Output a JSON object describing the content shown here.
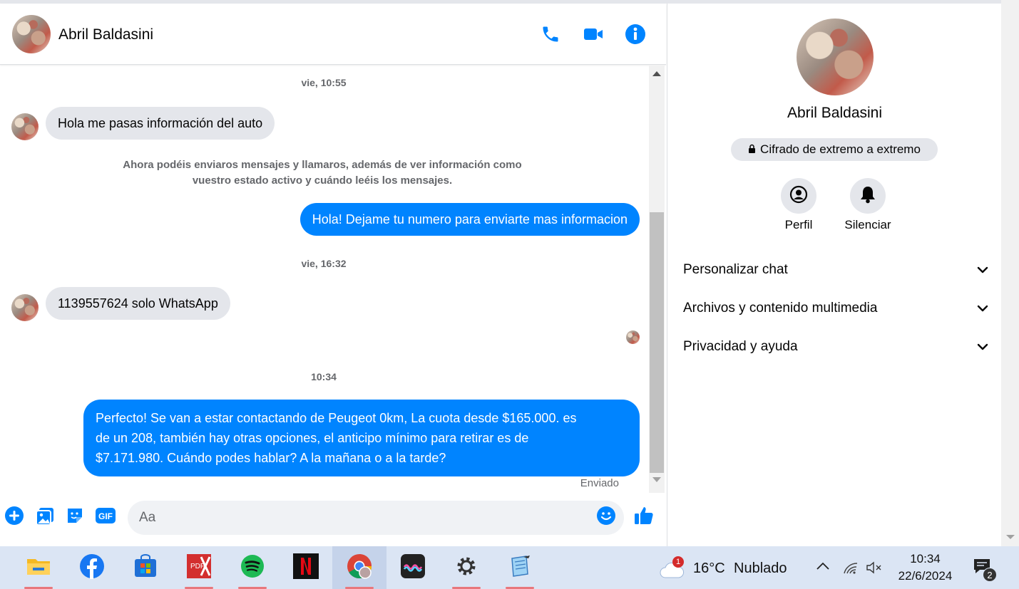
{
  "contact": {
    "name": "Abril Baldasini"
  },
  "header_icons": [
    "phone-icon",
    "video-call-icon",
    "info-icon"
  ],
  "messages": {
    "time1": "vie, 10:55",
    "in1": "Hola me pasas información del auto",
    "system_line1": "Ahora podéis enviaros mensajes y llamaros, además de ver información como",
    "system_line2": "vuestro estado activo y cuándo leéis los mensajes.",
    "out1": "Hola! Dejame tu numero para enviarte mas informacion",
    "time2": "vie, 16:32",
    "in2": "1139557624 solo WhatsApp",
    "time3": "10:34",
    "out2_line1": "Perfecto!  Se van a estar contactando de Peugeot 0km, La cuota desde $165.000. es",
    "out2_line2": "de un 208, también hay otras opciones, el anticipo mínimo para retirar es de",
    "out2_line3": "$7.171.980. Cuándo podes hablar? A la mañana o a la tarde?",
    "status": "Enviado"
  },
  "composer": {
    "placeholder": "Aa"
  },
  "panel": {
    "name": "Abril Baldasini",
    "encryption": "Cifrado de extremo a extremo",
    "profile_label": "Perfil",
    "mute_label": "Silenciar",
    "sections": [
      "Personalizar chat",
      "Archivos y contenido multimedia",
      "Privacidad y ayuda"
    ]
  },
  "taskbar": {
    "apps": [
      "file-explorer",
      "facebook",
      "microsoft-store",
      "pdf-viewer",
      "spotify",
      "netflix",
      "chrome",
      "app-launcher",
      "settings",
      "notepad"
    ],
    "weather_badge": "1",
    "temperature": "16°C",
    "weather": "Nublado",
    "time": "10:34",
    "date": "22/6/2024",
    "notifications": "2"
  },
  "colors": {
    "messenger_blue": "#0084ff",
    "bubble_gray": "#e4e6eb",
    "secondary_text": "#65676b"
  }
}
